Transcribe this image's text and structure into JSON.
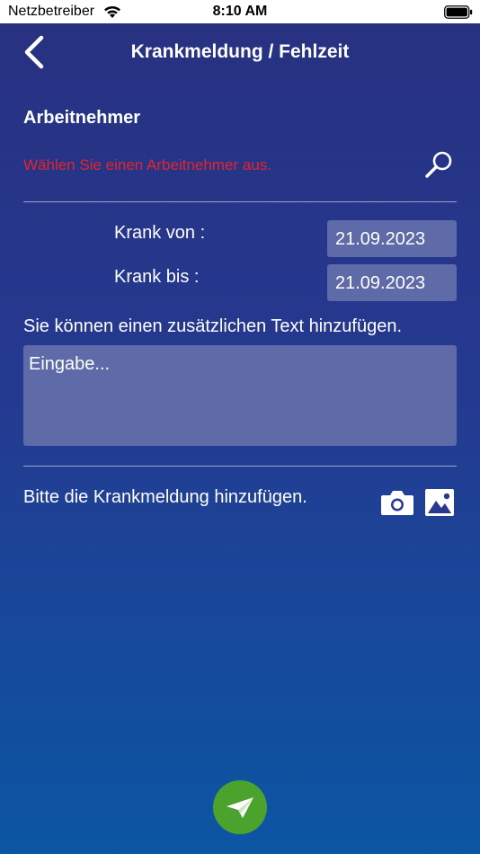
{
  "status_bar": {
    "carrier": "Netzbetreiber",
    "time": "8:10 AM"
  },
  "nav": {
    "title": "Krankmeldung / Fehlzeit",
    "back_icon": "chevron-left-icon"
  },
  "employee": {
    "section_title": "Arbeitnehmer",
    "prompt": "Wählen Sie einen Arbeitnehmer aus.",
    "prompt_color": "#e8222d",
    "search_icon": "search-icon"
  },
  "sick_period": {
    "from_label": "Krank von :",
    "from_value": "21.09.2023",
    "to_label": "Krank bis :",
    "to_value": "21.09.2023"
  },
  "note": {
    "hint": "Sie können einen zusätzlichen Text hinzufügen.",
    "placeholder": "Eingabe..."
  },
  "attachment": {
    "hint": "Bitte die Krankmeldung hinzufügen.",
    "camera_icon": "camera-icon",
    "gallery_icon": "image-icon"
  },
  "send": {
    "icon": "paper-plane-icon",
    "color": "#4ba22c"
  },
  "colors": {
    "background_top": "#283181",
    "background_bottom": "#0b56a3",
    "field_background": "#5f6aa8"
  }
}
